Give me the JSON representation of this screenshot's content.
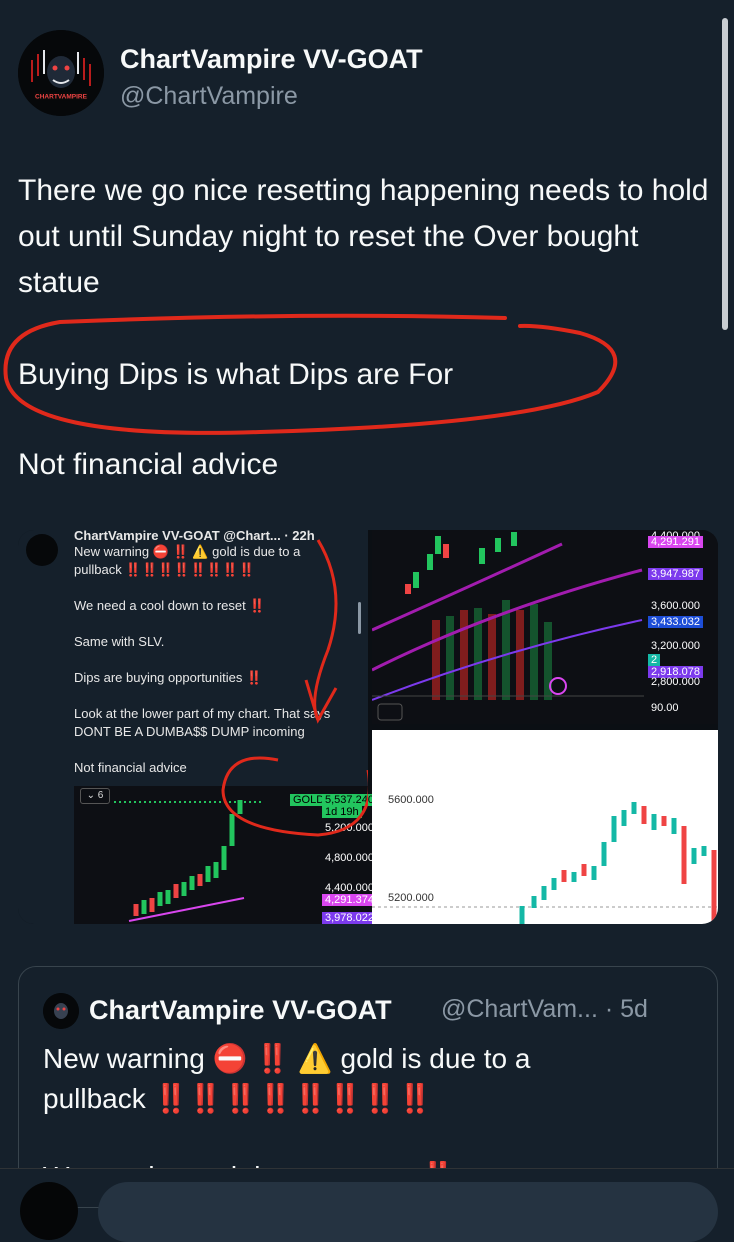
{
  "author": {
    "name": "ChartVampire VV-GOAT",
    "handle": "@ChartVampire",
    "avatar_label": "CHARTVAMPIRE"
  },
  "tweet": {
    "para1": "There we go nice resetting happening needs to hold out until Sunday night to reset the Over bought statue",
    "para2": "Buying Dips is what Dips are For",
    "para3": "Not financial advice"
  },
  "media": {
    "inner_post": {
      "header": "ChartVampire VV-GOAT @Chart... · 22h",
      "line1": "New warning ⛔ ‼️ ⚠️ gold is due to a",
      "line1b": "pullback ‼️‼️‼️‼️‼️‼️‼️‼️",
      "line2": "We need a cool down to reset ‼️",
      "line3": "Same with SLV.",
      "line4": "Dips are buying opportunities ‼️",
      "line5": "Look at the lower part of my chart. That says",
      "line5b": "DONT BE A DUMBA$$ DUMP incoming",
      "line6": "Not financial advice",
      "mini_chart_toolbar": "6",
      "price_labels": [
        "5,600.000",
        "GOLD",
        "5,537.240",
        "1d 19h",
        "5,200.000",
        "4,800.000",
        "4,400.000",
        "4,291.374",
        "3,978.022"
      ]
    },
    "top_right_chart": {
      "price_labels": [
        "4,400.000",
        "4,291.291",
        "3,947.987",
        "3,600.000",
        "3,433.032",
        "3,200.000",
        "2",
        "2,918.078",
        "2,800.000",
        "90.00"
      ]
    },
    "bottom_right_chart": {
      "price_labels": [
        "5600.000",
        "5200.000"
      ]
    }
  },
  "quote": {
    "name": "ChartVampire VV-GOAT",
    "handle": "@ChartVam...",
    "time": "· 5d",
    "line1": "New warning ⛔ ‼️ ⚠️ gold is due to a",
    "line2": "pullback ‼️‼️‼️‼️‼️‼️‼️‼️",
    "line3": "We need a cool down to reset ‼️"
  },
  "colors": {
    "background": "#15202b",
    "text": "#f7f9f9",
    "secondary": "#8b98a5",
    "annotation": "#e0291b",
    "up": "#22c55e",
    "down": "#ef4444",
    "magenta": "#d946ef"
  }
}
